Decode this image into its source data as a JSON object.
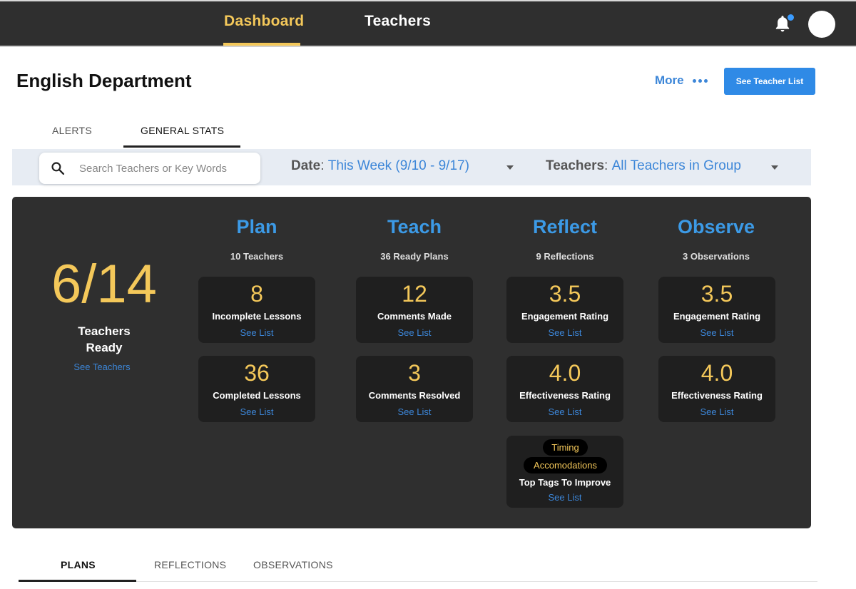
{
  "nav": {
    "tabs": [
      {
        "label": "Dashboard",
        "active": true
      },
      {
        "label": "Teachers",
        "active": false
      }
    ],
    "notification_dot_color": "#3b9cff",
    "accent_color": "#f4c85a"
  },
  "header": {
    "title": "English Department",
    "more_label": "More",
    "teacher_list_button": "See Teacher List"
  },
  "sub_tabs": [
    {
      "label": "ALERTS",
      "active": false
    },
    {
      "label": "GENERAL STATS",
      "active": true
    }
  ],
  "filters": {
    "search_placeholder": "Search Teachers or Key Words",
    "date_label": "Date",
    "date_value": "This Week (9/10 - 9/17)",
    "teachers_label": "Teachers",
    "teachers_value": "All Teachers in Group"
  },
  "summary": {
    "value": "6/14",
    "label_line1": "Teachers",
    "label_line2": "Ready",
    "link": "See Teachers"
  },
  "columns": [
    {
      "title": "Plan",
      "subtitle": "10 Teachers",
      "cards": [
        {
          "value": "8",
          "label": "Incomplete Lessons",
          "link": "See List"
        },
        {
          "value": "36",
          "label": "Completed Lessons",
          "link": "See List"
        }
      ]
    },
    {
      "title": "Teach",
      "subtitle": "36 Ready Plans",
      "cards": [
        {
          "value": "12",
          "label": "Comments Made",
          "link": "See List"
        },
        {
          "value": "3",
          "label": "Comments Resolved",
          "link": "See List"
        }
      ]
    },
    {
      "title": "Reflect",
      "subtitle": "9 Reflections",
      "cards": [
        {
          "value": "3.5",
          "label": "Engagement Rating",
          "link": "See List"
        },
        {
          "value": "4.0",
          "label": "Effectiveness Rating",
          "link": "See List"
        }
      ],
      "tags_card": {
        "tags": [
          "Timing",
          "Accomodations"
        ],
        "label": "Top Tags To Improve",
        "link": "See List"
      }
    },
    {
      "title": "Observe",
      "subtitle": "3 Observations",
      "cards": [
        {
          "value": "3.5",
          "label": "Engagement Rating",
          "link": "See List"
        },
        {
          "value": "4.0",
          "label": "Effectiveness Rating",
          "link": "See List"
        }
      ]
    }
  ],
  "bottom_tabs": [
    {
      "label": "PLANS",
      "active": true
    },
    {
      "label": "REFLECTIONS",
      "active": false
    },
    {
      "label": "OBSERVATIONS",
      "active": false
    }
  ]
}
